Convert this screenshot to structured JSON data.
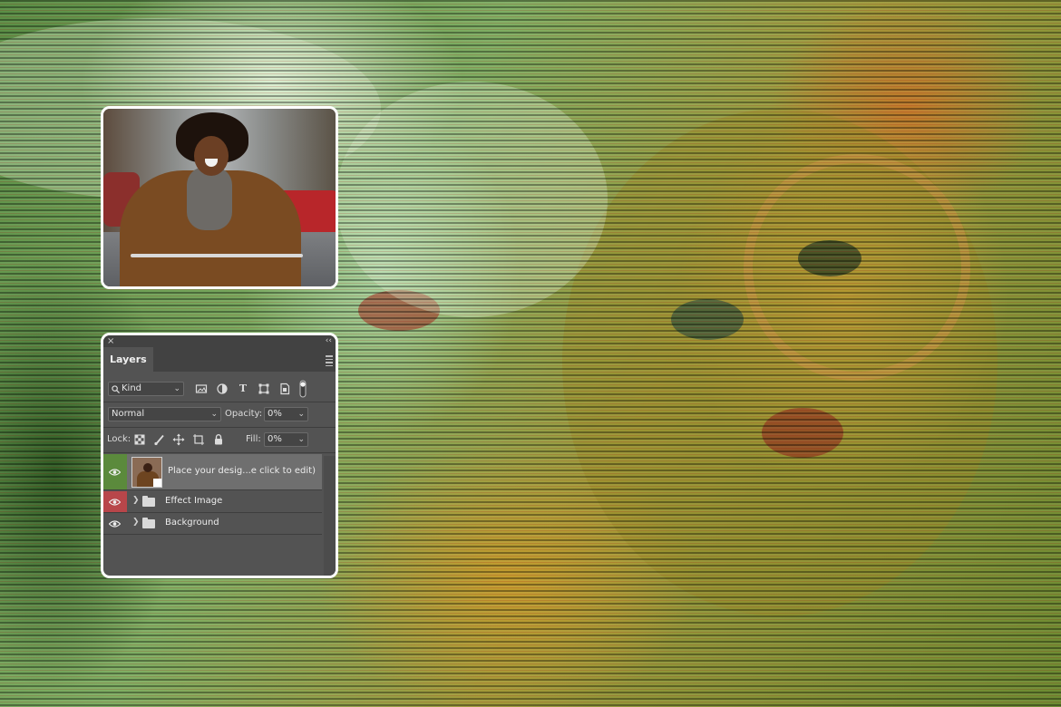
{
  "colors": {
    "panel_bg": "#535353",
    "panel_dark": "#424242",
    "selected_row": "#6f6f6f",
    "eye_green": "#5b8a3c",
    "eye_red": "#b8464a",
    "card_border": "#ffffff"
  },
  "panel": {
    "close_icon": "×",
    "collapse_icon": "‹‹",
    "tab_label": "Layers",
    "filter": {
      "search_icon": "search-icon",
      "kind_label": "Kind",
      "icons": [
        "image-filter-icon",
        "adjustment-filter-icon",
        "type-filter-icon",
        "shape-filter-icon",
        "smart-object-filter-icon",
        "filter-toggle-icon"
      ]
    },
    "blend_mode": "Normal",
    "opacity_label": "Opacity:",
    "opacity_value": "0%",
    "lock_label": "Lock:",
    "lock_icons": [
      "lock-transparent-pixels-icon",
      "lock-image-pixels-icon",
      "lock-position-icon",
      "lock-artboard-icon",
      "lock-all-icon"
    ],
    "fill_label": "Fill:",
    "fill_value": "0%"
  },
  "layers": [
    {
      "name": "Place your desig...e click to edit)",
      "type": "smart-object",
      "visible": true,
      "eye_color": "green",
      "selected": true
    },
    {
      "name": "Effect Image",
      "type": "group",
      "visible": true,
      "eye_color": "red",
      "selected": false
    },
    {
      "name": "Background",
      "type": "group",
      "visible": true,
      "eye_color": "none",
      "selected": false
    }
  ]
}
